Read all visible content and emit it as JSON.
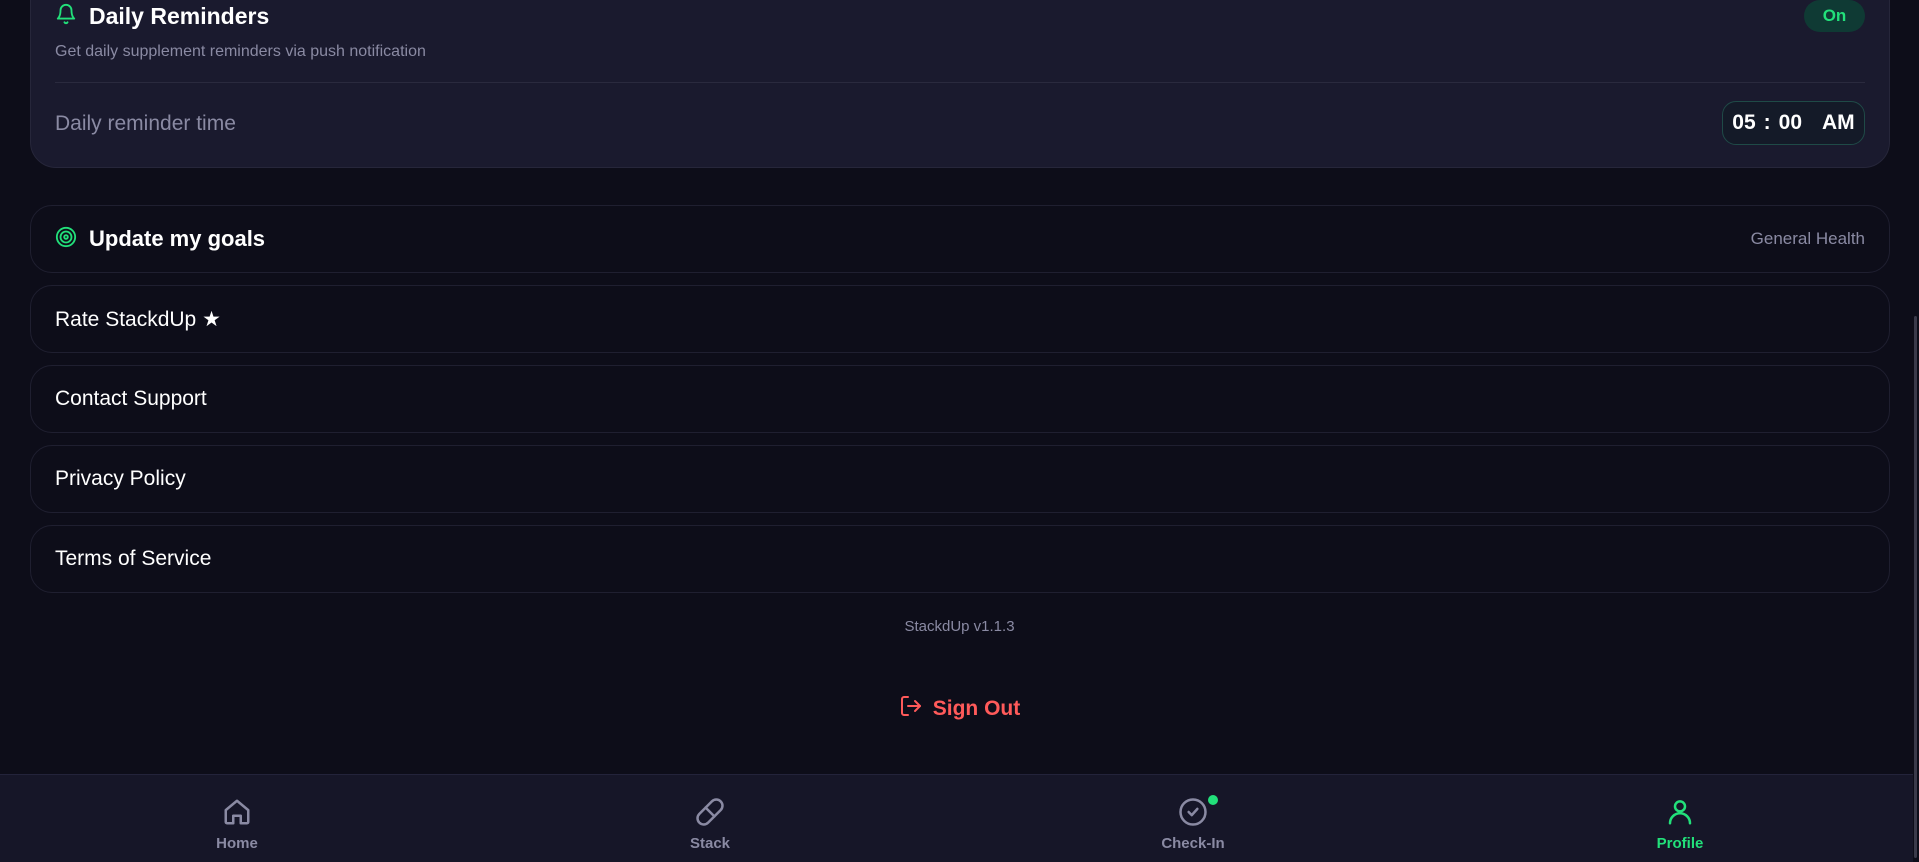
{
  "reminders": {
    "title": "Daily Reminders",
    "subtitle": "Get daily supplement reminders via push notification",
    "toggle_label": "On",
    "time_label": "Daily reminder time",
    "time_hour": "05",
    "time_minute": "00",
    "time_ampm": "AM",
    "icon": "bell-icon"
  },
  "goals": {
    "label": "Update my goals",
    "value": "General Health",
    "icon": "target-icon"
  },
  "menu": {
    "rate": "Rate StackdUp ★",
    "support": "Contact Support",
    "privacy": "Privacy Policy",
    "terms": "Terms of Service"
  },
  "version": "StackdUp v1.1.3",
  "sign_out": "Sign Out",
  "nav": {
    "home": "Home",
    "stack": "Stack",
    "checkin": "Check-In",
    "profile": "Profile",
    "active": "profile"
  },
  "colors": {
    "background": "#0d0d19",
    "card": "#1a1a2e",
    "accent": "#22e07a",
    "danger": "#ff5a5a",
    "muted": "#8a8aa3"
  }
}
